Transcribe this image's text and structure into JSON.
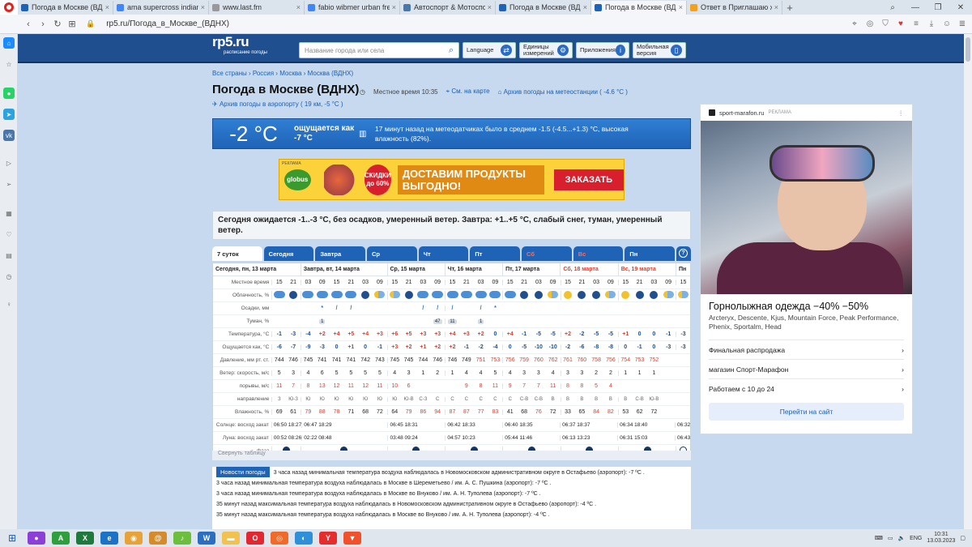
{
  "browser": {
    "tabs": [
      {
        "label": "Погода в Москве (ВДН)",
        "color": "#1f63b6",
        "active": false
      },
      {
        "label": "ama supercross indianapol",
        "color": "#4285f4",
        "active": false
      },
      {
        "label": "www.last.fm",
        "color": "#999999",
        "active": false
      },
      {
        "label": "fabio wibmer urban freeride",
        "color": "#4285f4",
        "active": false
      },
      {
        "label": "Автоспорт & Мотоспорт",
        "color": "#4a76a8",
        "active": false
      },
      {
        "label": "Погода в Москве (ВДН)",
        "color": "#1f63b6",
        "active": false
      },
      {
        "label": "Погода в Москве (ВДН)",
        "color": "#1f63b6",
        "active": true
      },
      {
        "label": "Ответ в Приглашаю жела",
        "color": "#f2a01e",
        "active": false
      }
    ],
    "url": "rp5.ru/Погода_в_Москве_(ВДНХ)"
  },
  "site": {
    "logo": "rp5.ru",
    "logo_sub": "расписание погоды",
    "search_placeholder": "Название города или села",
    "buttons": {
      "language": "Language",
      "units": "Единицы измерений",
      "apps": "Приложения",
      "mobile": "Мобильная версия"
    }
  },
  "page": {
    "breadcrumb": "Все страны › Россия › Москва › Москва (ВДНХ)",
    "title": "Погода в Москве (ВДНХ)",
    "local_time_label": "Местное время",
    "local_time": "10:35",
    "map_link": "См. на карте",
    "archive_link": "Архив погоды на метеостанции ( -4.6 °C )",
    "airport_link": "Архив погоды в аэропорту ( 19 км, -5 °C )",
    "current_temp": "-2 °C",
    "feels_like": "ощущается как -7 °C",
    "current_desc": "17 минут назад на метеодатчиках было в среднем -1.5 (-4.5...+1.3) °C, высокая влажность (82%).",
    "forecast_text": "Сегодня ожидается -1..-3 °C, без осадков, умеренный ветер. Завтра: +1..+5 °C, слабый снег, туман, умеренный ветер.",
    "collapse_label": "Свернуть таблицу",
    "news_label": "Новости погоды"
  },
  "ad_banner": {
    "tag": "РЕКЛАМА",
    "brand": "globus",
    "discount": "СКИДКИ до 60%",
    "slogan": "ДОСТАВИМ ПРОДУКТЫ ВЫГОДНО!",
    "button": "ЗАКАЗАТЬ"
  },
  "forecast_tabs": [
    {
      "label": "7 суток",
      "active": true,
      "red": false
    },
    {
      "label": "Сегодня",
      "active": false,
      "red": false
    },
    {
      "label": "Завтра",
      "active": false,
      "red": false
    },
    {
      "label": "Ср",
      "active": false,
      "red": false
    },
    {
      "label": "Чт",
      "active": false,
      "red": false
    },
    {
      "label": "Пт",
      "active": false,
      "red": false
    },
    {
      "label": "Сб",
      "active": false,
      "red": true
    },
    {
      "label": "Вс",
      "active": false,
      "red": true
    },
    {
      "label": "Пн",
      "active": false,
      "red": false
    }
  ],
  "table": {
    "days": [
      {
        "label": "Сегодня, пн, 13 марта",
        "cols": 2,
        "red": false
      },
      {
        "label": "Завтра, вт, 14 марта",
        "cols": 6,
        "red": false
      },
      {
        "label": "Ср, 15 марта",
        "cols": 4,
        "red": false
      },
      {
        "label": "Чт, 16 марта",
        "cols": 4,
        "red": false
      },
      {
        "label": "Пт, 17 марта",
        "cols": 4,
        "red": false
      },
      {
        "label": "Сб, 18 марта",
        "cols": 4,
        "red": true
      },
      {
        "label": "Вс, 19 марта",
        "cols": 4,
        "red": true
      },
      {
        "label": "Пн",
        "cols": 1,
        "red": false
      }
    ],
    "rows": {
      "time": {
        "label": "Местное время",
        "values": [
          "15",
          "21",
          "03",
          "09",
          "15",
          "21",
          "03",
          "09",
          "15",
          "21",
          "03",
          "09",
          "15",
          "21",
          "03",
          "09",
          "15",
          "21",
          "03",
          "09",
          "15",
          "21",
          "03",
          "09",
          "15",
          "21",
          "03",
          "09",
          "15",
          "21",
          "03"
        ]
      },
      "clouds": {
        "label": "Облачность, %",
        "values": [
          "cloud",
          "night",
          "cloud",
          "cloud",
          "cloud",
          "cloud",
          "night",
          "part",
          "part",
          "night",
          "cloud",
          "cloud",
          "cloud",
          "cloud",
          "cloud",
          "cloud",
          "cloud",
          "night",
          "night",
          "part",
          "sunny",
          "night",
          "night",
          "part",
          "sunny",
          "night",
          "night",
          "part",
          "part",
          "night",
          "night"
        ]
      },
      "precip": {
        "label": "Осадки, мм",
        "values": [
          "",
          "",
          "",
          "*",
          "/",
          "/",
          "",
          "",
          "",
          "",
          "/",
          "/",
          "/",
          "",
          "/",
          "*",
          "",
          "",
          "",
          "",
          "",
          "",
          "",
          "",
          "",
          "",
          "",
          "",
          "",
          "",
          ""
        ]
      },
      "fog": {
        "label": "Туман, %",
        "values": [
          "",
          "",
          "",
          "1",
          "",
          "",
          "",
          "",
          "",
          "",
          "",
          "47",
          "11",
          "",
          "1",
          "",
          "",
          "",
          "",
          "",
          "",
          "",
          "",
          "",
          "",
          "",
          "",
          "",
          "",
          "",
          ""
        ]
      },
      "temp": {
        "label": "Температура, °C",
        "values": [
          "-1",
          "-3",
          "-4",
          "+2",
          "+4",
          "+5",
          "+4",
          "+3",
          "+6",
          "+5",
          "+3",
          "+3",
          "+4",
          "+3",
          "+2",
          "0",
          "+4",
          "-1",
          "-5",
          "-5",
          "+2",
          "-2",
          "-5",
          "-5",
          "+1",
          "0",
          "0",
          "-1",
          "-3",
          "-6",
          "-1"
        ]
      },
      "feels": {
        "label": "Ощущается как, °C",
        "values": [
          "-6",
          "-7",
          "-9",
          "-3",
          "0",
          "+1",
          "0",
          "-1",
          "+3",
          "+2",
          "+1",
          "+2",
          "+2",
          "-1",
          "-2",
          "-4",
          "0",
          "-5",
          "-10",
          "-10",
          "-2",
          "-6",
          "-8",
          "-8",
          "0",
          "-1",
          "0",
          "-3",
          "-3",
          "-5",
          "-1"
        ]
      },
      "pressure": {
        "label": "Давление, мм рт. ст.",
        "values": [
          "744",
          "746",
          "745",
          "741",
          "741",
          "741",
          "742",
          "743",
          "745",
          "745",
          "744",
          "746",
          "746",
          "749",
          "751",
          "753",
          "756",
          "759",
          "760",
          "762",
          "761",
          "760",
          "758",
          "756",
          "754",
          "753",
          "752",
          "",
          "",
          "",
          ""
        ]
      },
      "wind": {
        "label": "Ветер: скорость, м/с",
        "values": [
          "5",
          "3",
          "4",
          "6",
          "5",
          "5",
          "5",
          "5",
          "4",
          "3",
          "1",
          "2",
          "1",
          "4",
          "4",
          "5",
          "4",
          "3",
          "3",
          "4",
          "3",
          "3",
          "2",
          "2",
          "1",
          "1",
          "1",
          "",
          "",
          "",
          ""
        ]
      },
      "gusts": {
        "label": "порывы, м/с",
        "values": [
          "11",
          "7",
          "8",
          "13",
          "12",
          "11",
          "12",
          "11",
          "10",
          "6",
          "",
          "",
          "",
          "9",
          "8",
          "11",
          "9",
          "7",
          "7",
          "11",
          "8",
          "8",
          "5",
          "4",
          "",
          "",
          "",
          "",
          "",
          "",
          ""
        ]
      },
      "dir": {
        "label": "направление",
        "values": [
          "З",
          "Ю-З",
          "Ю",
          "Ю",
          "Ю",
          "Ю",
          "Ю",
          "Ю",
          "Ю",
          "Ю-В",
          "С-З",
          "С",
          "С",
          "С",
          "С",
          "С",
          "С",
          "С-В",
          "С-В",
          "В",
          "В",
          "В",
          "В",
          "В",
          "В",
          "С-В",
          "Ю-В",
          "",
          "",
          "",
          ""
        ]
      },
      "humidity": {
        "label": "Влажность, %",
        "values": [
          "69",
          "61",
          "79",
          "88",
          "78",
          "71",
          "68",
          "72",
          "64",
          "79",
          "86",
          "94",
          "87",
          "87",
          "77",
          "83",
          "41",
          "68",
          "76",
          "72",
          "33",
          "65",
          "84",
          "82",
          "53",
          "62",
          "72",
          "",
          "",
          "",
          ""
        ]
      },
      "sun": {
        "label": "Солнце: восход закат",
        "values": [
          "06:50 18:27",
          "06:47 18:29",
          "06:45 18:31",
          "06:42 18:33",
          "06:40 18:35",
          "06:37 18:37",
          "06:34 18:40",
          "06:32"
        ]
      },
      "moon": {
        "label": "Луна: восход закат",
        "values": [
          "00:52 08:26",
          "02:22 08:48",
          "03:48 09:24",
          "04:57 10:23",
          "05:44 11:46",
          "06:13 13:23",
          "06:31 15:03",
          "06:43"
        ]
      },
      "phase_label": "фаза"
    }
  },
  "news_items": [
    "3 часа назад минимальная температура воздуха наблюдалась в Новомосковском административном округе в Остафьево (аэропорт): -7 ºC .",
    "3 часа назад минимальная температура воздуха наблюдалась в Москве в Шереметьево / им. А. С. Пушкина (аэропорт): -7 ºC .",
    "3 часа назад минимальная температура воздуха наблюдалась в Москве во Внуково / им. А. Н. Туполева (аэропорт): -7 ºC .",
    "35 минут назад максимальная температура воздуха наблюдалась в Новомосковском административном округе в Остафьево (аэропорт): -4 ºC .",
    "35 минут назад максимальная температура воздуха наблюдалась в Москве во Внуково / им. А. Н. Туполева (аэропорт): -4 ºC ."
  ],
  "right_ad": {
    "source": "sport-marafon.ru",
    "tag": "РЕКЛАМА",
    "headline": "Горнолыжная одежда −40% −50%",
    "sub": "Arcteryx, Descente, Kjus, Mountain Force, Peak Performance, Phenix, Sportalm, Head",
    "items": [
      "Финальная распродажа",
      "магазин Спорт-Марафон",
      "Работаем с 10 до 24"
    ],
    "cta": "Перейти на сайт"
  },
  "taskbar": {
    "lang": "ENG",
    "time": "10:31",
    "date": "13.03.2023"
  }
}
